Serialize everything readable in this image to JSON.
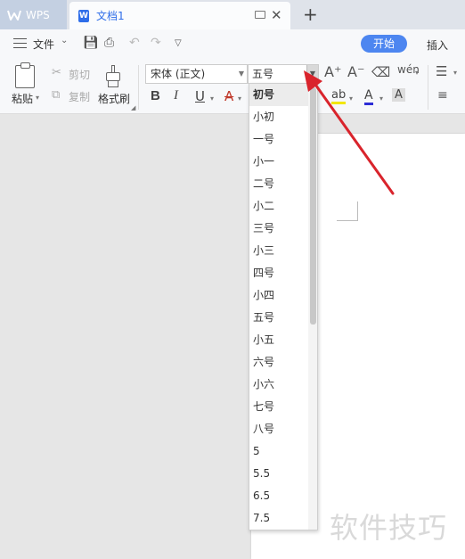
{
  "tabs": {
    "home_label": "WPS",
    "doc_label": "文档1"
  },
  "menu": {
    "file_label": "文件",
    "start_label": "开始",
    "insert_label": "插入"
  },
  "clipboard": {
    "paste_label": "粘贴",
    "cut_label": "剪切",
    "copy_label": "复制",
    "format_painter_label": "格式刷"
  },
  "font": {
    "name_value": "宋体 (正文)",
    "size_value": "五号"
  },
  "font_size_options": [
    "初号",
    "小初",
    "一号",
    "小一",
    "二号",
    "小二",
    "三号",
    "小三",
    "四号",
    "小四",
    "五号",
    "小五",
    "六号",
    "小六",
    "七号",
    "八号",
    "5",
    "5.5",
    "6.5",
    "7.5"
  ],
  "selected_option_index": 0,
  "format_buttons": {
    "bold": "B",
    "italic": "I",
    "underline": "U",
    "strike": "A",
    "grow": "A⁺",
    "shrink": "A⁻",
    "color_a": "A",
    "shade_a": "A",
    "highlight": "ab",
    "phonetic": "wén"
  },
  "watermark_text": "软件技巧",
  "colors": {
    "accent": "#4d86f0",
    "doc_tab_text": "#2f6ee9",
    "arrow": "#d9242c"
  }
}
